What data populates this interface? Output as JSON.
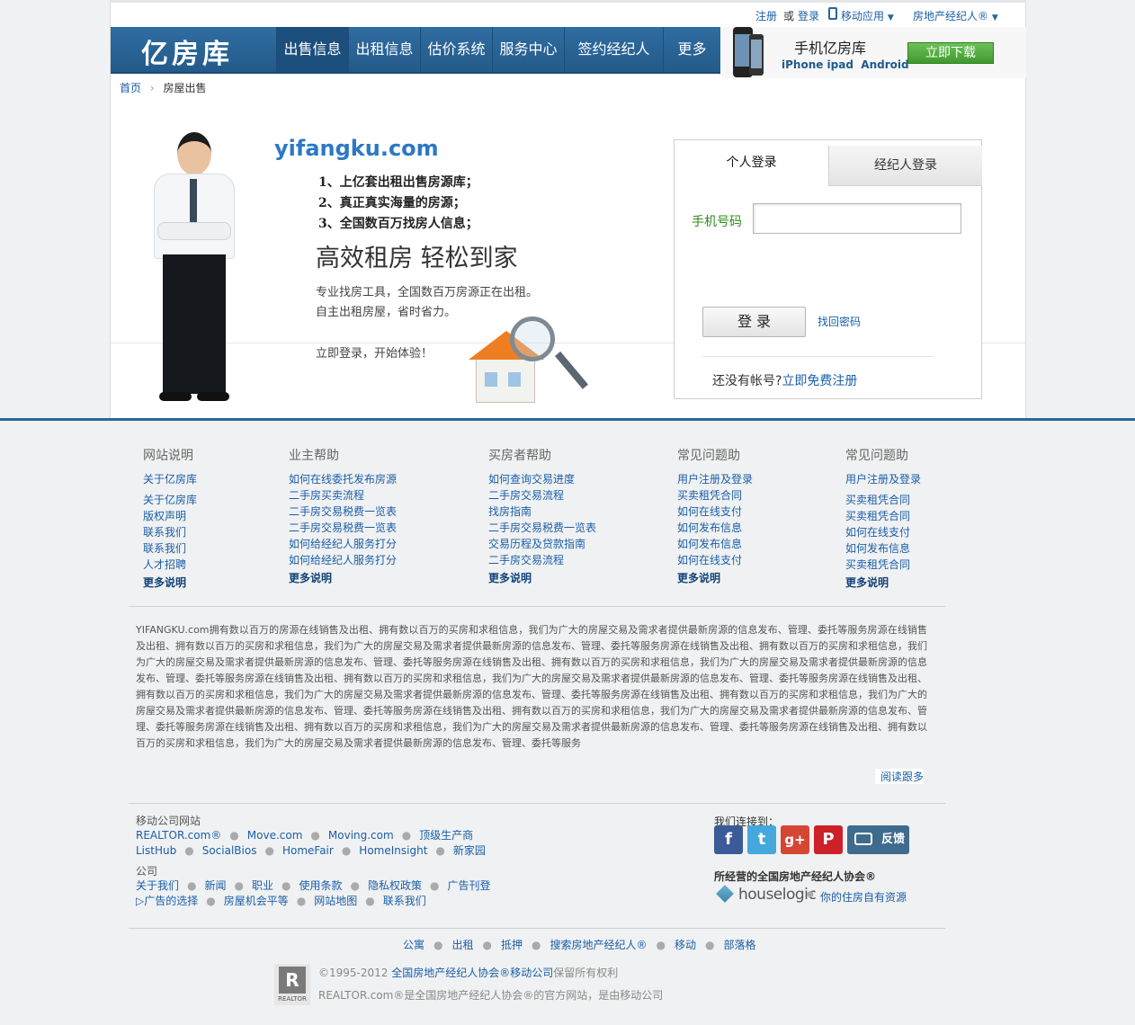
{
  "top": {
    "register": "注册",
    "or": "或",
    "login": "登录",
    "mobile_app": "移动应用",
    "agent": "房地产经纪人®"
  },
  "brand": {
    "logo": "亿房库"
  },
  "nav": [
    "出售信息",
    "出租信息",
    "估价系统",
    "服务中心",
    "签约经纪人",
    "更多"
  ],
  "mobile_promo": {
    "title": "手机亿房库",
    "platforms": "iPhone ipad  Android",
    "download": "立即下载"
  },
  "breadcrumb": {
    "home": "首页",
    "current": "房屋出售"
  },
  "hero": {
    "domain": "yifangku.com",
    "points": [
      "1、上亿套出租出售房源库；",
      "2、真正真实海量的房源；",
      "3、全国数百万找房人信息；"
    ],
    "slogan": "高效租房 轻松到家",
    "sub1": "专业找房工具，全国数百万房源正在出租。",
    "sub2": "自主出租房屋，省时省力。",
    "cta": "立即登录，开始体验！"
  },
  "login": {
    "tab_personal": "个人登录",
    "tab_agent": "经纪人登录",
    "phone_label": "手机号码",
    "phone_value": "",
    "submit": "登 录",
    "forgot": "找回密码",
    "no_account": "还没有帐号?",
    "register": "立即免费注册"
  },
  "footer_cols": [
    {
      "title": "网站说明",
      "links": [
        "关于亿房库",
        "关于亿房库",
        "版权声明",
        "联系我们",
        "联系我们",
        "人才招聘"
      ],
      "more": "更多说明"
    },
    {
      "title": "业主帮助",
      "links": [
        "如何在线委托发布房源",
        "二手房买卖流程",
        "二手房交易税费一览表",
        "二手房交易税费一览表",
        "如何给经纪人服务打分",
        "如何给经纪人服务打分"
      ],
      "more": "更多说明"
    },
    {
      "title": "买房者帮助",
      "links": [
        "如何查询交易进度",
        "二手房交易流程",
        "找房指南",
        "二手房交易税费一览表",
        "交易历程及贷款指南",
        "二手房交易流程"
      ],
      "more": "更多说明"
    },
    {
      "title": "常见问题助",
      "links": [
        "用户注册及登录",
        "买卖租凭合同",
        "如何在线支付",
        "如何发布信息",
        "如何发布信息",
        "如何在线支付"
      ],
      "more": "更多说明"
    },
    {
      "title": "常见问题助",
      "links": [
        "用户注册及登录",
        "买卖租凭合同",
        "买卖租凭合同",
        "如何在线支付",
        "如何发布信息",
        "买卖租凭合同"
      ],
      "more": "更多说明"
    }
  ],
  "description": "YIFANGKU.com拥有数以百万的房源在线销售及出租、拥有数以百万的买房和求租信息，我们为广大的房屋交易及需求者提供最新房源的信息发布、管理、委托等服务房源在线销售及出租、拥有数以百万的买房和求租信息，我们为广大的房屋交易及需求者提供最新房源的信息发布、管理、委托等服务房源在线销售及出租、拥有数以百万的买房和求租信息，我们为广大的房屋交易及需求者提供最新房源的信息发布、管理、委托等服务房源在线销售及出租、拥有数以百万的买房和求租信息，我们为广大的房屋交易及需求者提供最新房源的信息发布、管理、委托等服务房源在线销售及出租、拥有数以百万的买房和求租信息，我们为广大的房屋交易及需求者提供最新房源的信息发布、管理、委托等服务房源在线销售及出租、拥有数以百万的买房和求租信息，我们为广大的房屋交易及需求者提供最新房源的信息发布、管理、委托等服务房源在线销售及出租、拥有数以百万的买房和求租信息，我们为广大的房屋交易及需求者提供最新房源的信息发布、管理、委托等服务房源在线销售及出租、拥有数以百万的买房和求租信息，我们为广大的房屋交易及需求者提供最新房源的信息发布、管理、委托等服务房源在线销售及出租、拥有数以百万的买房和求租信息，我们为广大的房屋交易及需求者提供最新房源的信息发布、管理、委托等服务房源在线销售及出租、拥有数以百万的买房和求租信息，我们为广大的房屋交易及需求者提供最新房源的信息发布、管理、委托等服务",
  "read_more": "阅读跟多",
  "mobile_sites": {
    "title": "移动公司网站",
    "row1": [
      "REALTOR.com®",
      "Move.com",
      "Moving.com",
      "顶级生产商"
    ],
    "row2": [
      "ListHub",
      "SocialBios",
      "HomeFair",
      "HomeInsight",
      "新家园"
    ]
  },
  "company": {
    "title": "公司",
    "row1": [
      "关于我们",
      "新闻",
      "职业",
      "使用条款",
      "隐私权政策",
      "广告刊登"
    ],
    "row2": [
      "广告的选择",
      "房屋机会平等",
      "网站地图",
      "联系我们"
    ]
  },
  "social": {
    "title": "我们连接到：",
    "feedback": "反馈"
  },
  "association": {
    "title": "所经营的全国房地产经纪人协会®",
    "houselogic": "houselogic",
    "resource": "你的住房自有资源"
  },
  "bottom_links": [
    "公寓",
    "出租",
    "抵押",
    "搜索房地产经纪人®",
    "移动",
    "部落格"
  ],
  "copyright": {
    "year": "©1995-2012",
    "assoc": "全国房地产经纪人协会®",
    "move": "移动公司",
    "rights": "保留所有权利",
    "line2": "REALTOR.com®是全国房地产经纪人协会®的官方网站，是由移动公司",
    "realtor": "REALTOR"
  },
  "colors": {
    "nav_blue": "#2a6597",
    "link": "#1a5ea8",
    "green": "#4caf3a"
  }
}
